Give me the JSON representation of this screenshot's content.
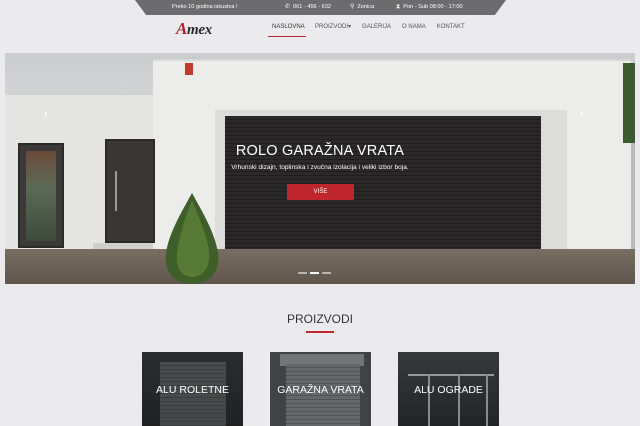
{
  "topbar": {
    "experience": "Preko 10 godina iskustva !",
    "phone": "061 - 456 - 632",
    "phone_icon": "phone-icon",
    "location": "Zenica",
    "location_icon": "map-pin-icon",
    "hours": "Pon - Sub 08:00 - 17:00",
    "hours_icon": "hourglass-icon"
  },
  "logo": {
    "first": "A",
    "rest": "mex"
  },
  "nav": {
    "items": [
      "NASLOVNA",
      "PROIZVODI",
      "GALERIJA",
      "O NAMA",
      "KONTAKT"
    ],
    "active_index": 0,
    "dropdown_caret": "▾"
  },
  "hero": {
    "title": "ROLO GARAŽNA VRATA",
    "subtitle": "Vrhunski dizajn, toplinska i zvučna izolacija i veliki izbor boja.",
    "button": "VIŠE",
    "prev": "‹",
    "next": "›",
    "slides": 3,
    "active_slide": 1
  },
  "products": {
    "title": "PROIZVODI",
    "cards": [
      "ALU ROLETNE",
      "GARAŽNA VRATA",
      "ALU OGRADE"
    ]
  },
  "colors": {
    "accent": "#c0262d",
    "topbar_bg": "#6c6c6e",
    "page_bg": "#ebebee"
  }
}
